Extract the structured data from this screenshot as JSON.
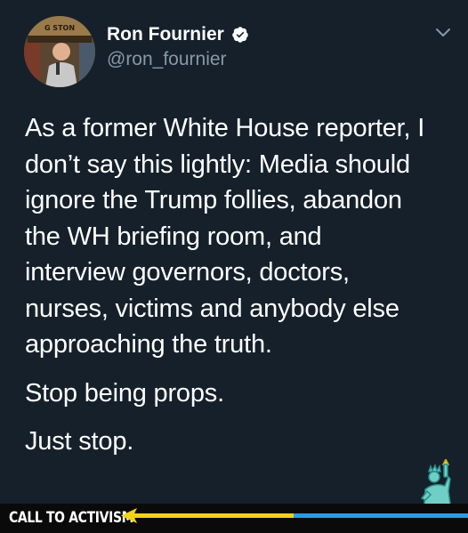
{
  "tweet": {
    "display_name": "Ron Fournier",
    "handle": "@ron_fournier",
    "verified": true,
    "avatar_sign_text": "G STON",
    "paragraphs": [
      "As a former White House reporter, I\ndon’t say this lightly: Media should\nignore the Trump follies, abandon\nthe WH briefing room, and\ninterview governors, doctors,\nnurses, victims and anybody else\napproaching the truth.",
      "Stop being props.",
      "Just stop."
    ]
  },
  "footer": {
    "label": "CALL TO ACTIVISM"
  },
  "icons": {
    "verified": "verified-badge-icon",
    "menu": "chevron-down-icon",
    "arrow": "left-arrow-icon",
    "logo": "statue-of-liberty-icon"
  },
  "colors": {
    "background": "#15202b",
    "text": "#ffffff",
    "muted": "#8899a6",
    "footer_bg": "#0a0a0a",
    "arrow_yellow": "#f2d21b",
    "arrow_blue": "#2e9be0"
  }
}
